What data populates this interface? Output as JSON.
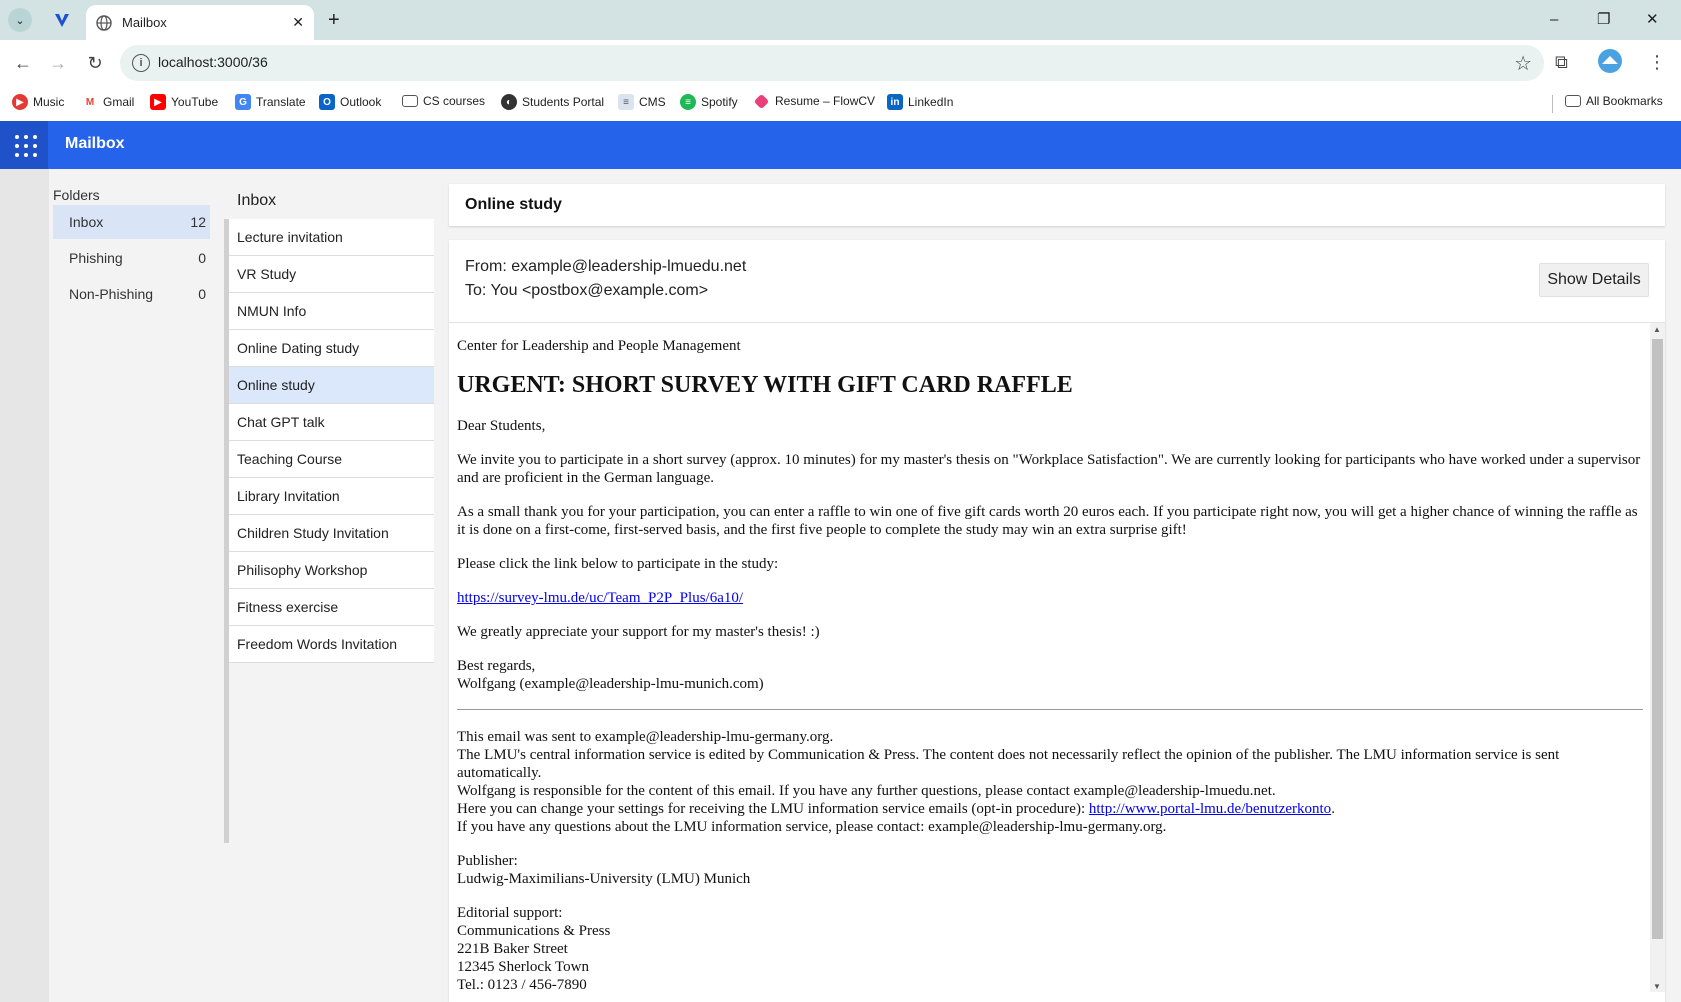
{
  "browser": {
    "tab_title": "Mailbox",
    "url": "localhost:3000/36",
    "bookmarks": [
      {
        "label": "Music",
        "icon": "music-icon",
        "color": "#e53935"
      },
      {
        "label": "Gmail",
        "icon": "gmail-icon",
        "color": "#ea4335"
      },
      {
        "label": "YouTube",
        "icon": "youtube-icon",
        "color": "#ff0000"
      },
      {
        "label": "Translate",
        "icon": "translate-icon",
        "color": "#4285f4"
      },
      {
        "label": "Outlook",
        "icon": "outlook-icon",
        "color": "#0a64c8"
      },
      {
        "label": "CS courses",
        "icon": "folder-icon",
        "color": "#555555"
      },
      {
        "label": "Students Portal",
        "icon": "globe-icon",
        "color": "#333333"
      },
      {
        "label": "CMS",
        "icon": "document-icon",
        "color": "#8aa0b8"
      },
      {
        "label": "Spotify",
        "icon": "spotify-icon",
        "color": "#1db954"
      },
      {
        "label": "Resume – FlowCV",
        "icon": "flowcv-icon",
        "color": "#e8407a"
      },
      {
        "label": "LinkedIn",
        "icon": "linkedin-icon",
        "color": "#0a66c2"
      }
    ],
    "all_bookmarks": "All Bookmarks"
  },
  "app": {
    "title": "Mailbox",
    "accent": "#2663eb"
  },
  "folders": {
    "header": "Folders",
    "items": [
      {
        "label": "Inbox",
        "count": "12",
        "active": true
      },
      {
        "label": "Phishing",
        "count": "0",
        "active": false
      },
      {
        "label": "Non-Phishing",
        "count": "0",
        "active": false
      }
    ]
  },
  "maillist": {
    "header": "Inbox",
    "items": [
      "Lecture invitation",
      "VR Study",
      "NMUN Info",
      "Online Dating study",
      "Online study",
      "Chat GPT talk",
      "Teaching Course",
      "Library Invitation",
      "Children Study Invitation",
      "Philisophy Workshop",
      "Fitness exercise",
      "Freedom Words Invitation"
    ],
    "active_index": 4
  },
  "message": {
    "subject": "Online study",
    "from": "From: example@leadership-lmuedu.net",
    "to": "To: You <postbox@example.com>",
    "show_details": "Show Details",
    "org": "Center for Leadership and People Management",
    "headline": "URGENT: SHORT SURVEY WITH GIFT CARD RAFFLE",
    "greeting": "Dear Students,",
    "para1": "We invite you to participate in a short survey (approx. 10 minutes) for my master's thesis on \"Workplace Satisfaction\". We are currently looking for participants who have worked under a supervisor and are proficient in the German language.",
    "para2": "As a small thank you for your participation, you can enter a raffle to win one of five gift cards worth 20 euros each. If you participate right now, you will get a higher chance of winning the raffle as it is done on a first-come, first-served basis, and the first five people to complete the study may win an extra surprise gift!",
    "para3": "Please click the link below to participate in the study:",
    "link": "https://survey-lmu.de/uc/Team_P2P_Plus/6a10/",
    "para4": "We greatly appreciate your support for my master's thesis! :)",
    "regards": "Best regards,",
    "signature": "Wolfgang (example@leadership-lmu-munich.com)",
    "footer1": "This email was sent to example@leadership-lmu-germany.org.",
    "footer2": "The LMU's central information service is edited by Communication & Press. The content does not necessarily reflect the opinion of the publisher. The LMU information service is sent automatically.",
    "footer3": "Wolfgang is responsible for the content of this email. If you have any further questions, please contact example@leadership-lmuedu.net.",
    "footer4_prefix": "Here you can change your settings for receiving the LMU information service emails (opt-in procedure): ",
    "footer4_link": "http://www.portal-lmu.de/benutzerkonto",
    "footer4_suffix": ".",
    "footer5": "If you have any questions about the LMU information service, please contact: example@leadership-lmu-germany.org.",
    "publisher_label": "Publisher:",
    "publisher": "Ludwig-Maximilians-University (LMU) Munich",
    "editorial_label": "Editorial support:",
    "editorial1": "Communications & Press",
    "editorial2": "221B Baker Street",
    "editorial3": "12345 Sherlock Town",
    "editorial4": "Tel.: 0123 / 456-7890"
  }
}
